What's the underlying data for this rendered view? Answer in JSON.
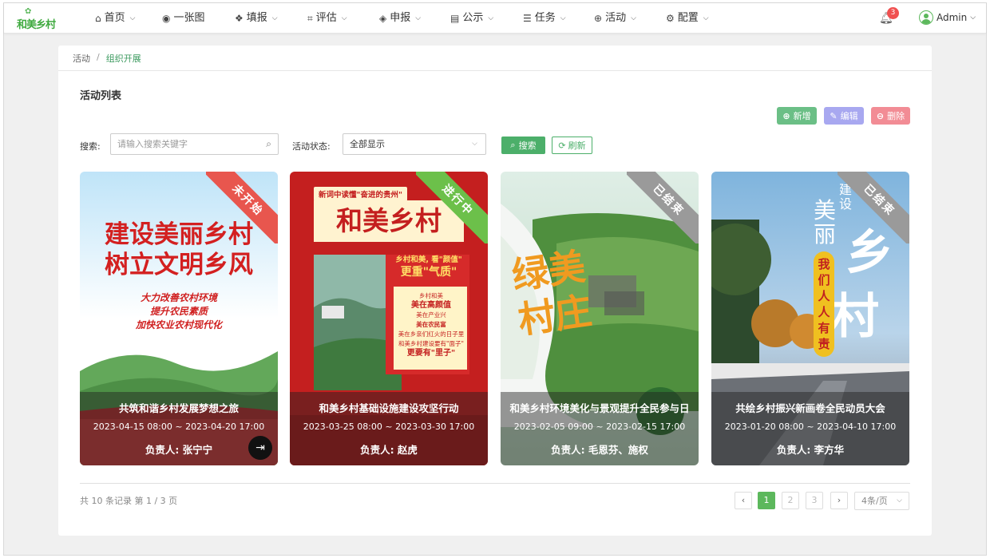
{
  "app": {
    "logo_text": "和美乡村"
  },
  "nav": {
    "items": [
      {
        "label": "首页",
        "icon": "home-icon",
        "glyph": "⌂",
        "chevron": true
      },
      {
        "label": "一张图",
        "icon": "globe-icon",
        "glyph": "◉",
        "chevron": false
      },
      {
        "label": "填报",
        "icon": "cubes-icon",
        "glyph": "❖",
        "chevron": true
      },
      {
        "label": "评估",
        "icon": "crop-icon",
        "glyph": "⌗",
        "chevron": true
      },
      {
        "label": "申报",
        "icon": "layers-icon",
        "glyph": "◈",
        "chevron": true
      },
      {
        "label": "公示",
        "icon": "newspaper-icon",
        "glyph": "▤",
        "chevron": true
      },
      {
        "label": "任务",
        "icon": "tasks-icon",
        "glyph": "☰",
        "chevron": true
      },
      {
        "label": "活动",
        "icon": "lifebuoy-icon",
        "glyph": "⊕",
        "chevron": true
      },
      {
        "label": "配置",
        "icon": "gear-icon",
        "glyph": "⚙",
        "chevron": true
      }
    ],
    "notification_count": "3",
    "user_name": "Admin"
  },
  "breadcrumb": {
    "parent": "活动",
    "separator": "/",
    "current": "组织开展"
  },
  "page": {
    "title": "活动列表",
    "actions": {
      "add": "新增",
      "edit": "编辑",
      "delete": "删除"
    },
    "filters": {
      "search_label": "搜索:",
      "search_placeholder": "请输入搜索关键字",
      "status_label": "活动状态:",
      "status_value": "全部显示",
      "search_button": "搜索",
      "refresh_button": "刷新"
    }
  },
  "cards": [
    {
      "status": "未开始",
      "status_color": "#e8564e",
      "title": "共筑和谐乡村发展梦想之旅",
      "dates": "2023-04-15 08:00 ~ 2023-04-20 17:00",
      "person": "负责人: 张宁宁",
      "poster": {
        "line1": "建设美丽乡村",
        "line2": "树立文明乡风",
        "sub1": "大力改善农村环境",
        "sub2": "提升农民素质",
        "sub3": "加快农业农村现代化"
      }
    },
    {
      "status": "进行中",
      "status_color": "#6cc04a",
      "title": "和美乡村基础设施建设攻坚行动",
      "dates": "2023-03-25 08:00 ~ 2023-03-30 17:00",
      "person": "负责人: 赵虎",
      "poster": {
        "tag": "新词中读懂\"奋进的贵州\"",
        "headline": "和美乡村",
        "quote1": "乡村和美, 看\"颜值\"",
        "quote2": "更重\"气质\"",
        "b1": "乡村和美",
        "b2": "美在高颜值",
        "b3": "美在产业兴",
        "b4": "美在农民富",
        "b5": "美在乡亲们红火的日子里",
        "b6": "和美乡村建设要有\"面子\"",
        "b7": "更要有\"里子\""
      }
    },
    {
      "status": "已结束",
      "status_color": "#9a9a9a",
      "title": "和美乡村环境美化与景观提升全民参与日",
      "dates": "2023-02-05 09:00 ~ 2023-02-15 17:00",
      "person": "负责人: 毛恩芬、施权",
      "poster": {
        "chars": "绿美村庄"
      }
    },
    {
      "status": "已结束",
      "status_color": "#9a9a9a",
      "title": "共绘乡村振兴新画卷全民动员大会",
      "dates": "2023-01-20 08:00 ~ 2023-04-10 17:00",
      "person": "负责人: 李方华",
      "poster": {
        "small": "建设",
        "mei_li": "美丽",
        "xiang": "乡",
        "cun": "村",
        "slogan": "我们人人有责"
      }
    }
  ],
  "pagination": {
    "summary": "共 10 条记录 第 1 / 3 页",
    "pages": [
      "1",
      "2",
      "3"
    ],
    "prev": "‹",
    "next": "›",
    "page_size": "4条/页"
  }
}
